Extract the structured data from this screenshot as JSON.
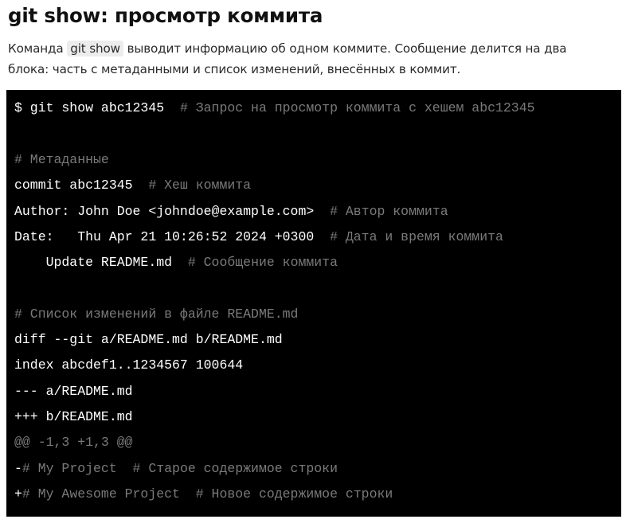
{
  "title": "git show: просмотр коммита",
  "intro": {
    "before": "Команда ",
    "code": "git show",
    "after_line1": " выводит информацию об одном коммите. Сообщение делится на два",
    "line2": "блока: часть с метаданными и список изменений, внесённых в коммит."
  },
  "code_lines": [
    {
      "text": "$ git show abc12345",
      "comment": "  # Запрос на просмотр коммита с хешем abc12345"
    },
    {
      "text": "",
      "comment": "# Метаданные"
    },
    {
      "text": "commit abc12345",
      "comment": "  # Хеш коммита"
    },
    {
      "text": "Author: John Doe <johndoe@example.com>",
      "comment": "  # Автор коммита"
    },
    {
      "text": "Date:   Thu Apr 21 10:26:52 2024 +0300",
      "comment": "  # Дата и время коммита"
    },
    {
      "text": "    Update README.md",
      "comment": "  # Сообщение коммита"
    },
    {
      "text": "",
      "comment": "# Список изменений в файле README.md"
    },
    {
      "text": "diff --git a/README.md b/README.md",
      "comment": ""
    },
    {
      "text": "index abcdef1..1234567 100644",
      "comment": ""
    },
    {
      "text": "--- a/README.md",
      "comment": ""
    },
    {
      "text": "+++ b/README.md",
      "comment": ""
    },
    {
      "text": "",
      "comment": "@@ -1,3 +1,3 @@"
    },
    {
      "text": "-",
      "comment": "# My Project  # Старое содержимое строки"
    },
    {
      "text": "+",
      "comment": "# My Awesome Project  # Новое содержимое строки"
    }
  ]
}
